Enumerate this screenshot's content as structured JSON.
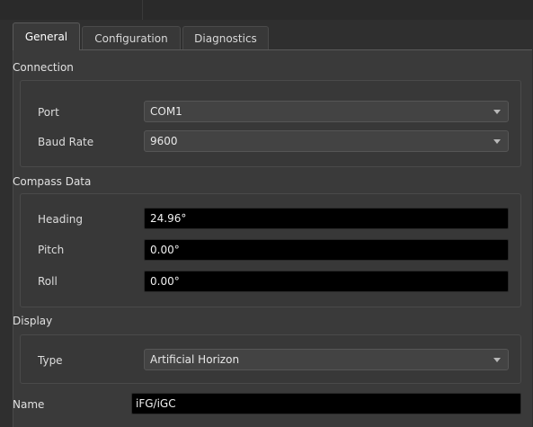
{
  "tabs": [
    {
      "label": "General",
      "active": true
    },
    {
      "label": "Configuration",
      "active": false
    },
    {
      "label": "Diagnostics",
      "active": false
    }
  ],
  "connection": {
    "title": "Connection",
    "port": {
      "label": "Port",
      "value": "COM1"
    },
    "baud_rate": {
      "label": "Baud Rate",
      "value": "9600"
    }
  },
  "compass_data": {
    "title": "Compass Data",
    "heading": {
      "label": "Heading",
      "value": "24.96°"
    },
    "pitch": {
      "label": "Pitch",
      "value": "0.00°"
    },
    "roll": {
      "label": "Roll",
      "value": "0.00°"
    }
  },
  "display": {
    "title": "Display",
    "type": {
      "label": "Type",
      "value": "Artificial Horizon"
    }
  },
  "name": {
    "label": "Name",
    "value": "iFG/iGC"
  },
  "colors": {
    "background": "#2f2f2f",
    "panel": "#3a3a3a",
    "field_background": "#000000",
    "text": "#dcdcdc"
  },
  "icons": {
    "dropdown": "chevron-down-icon"
  }
}
